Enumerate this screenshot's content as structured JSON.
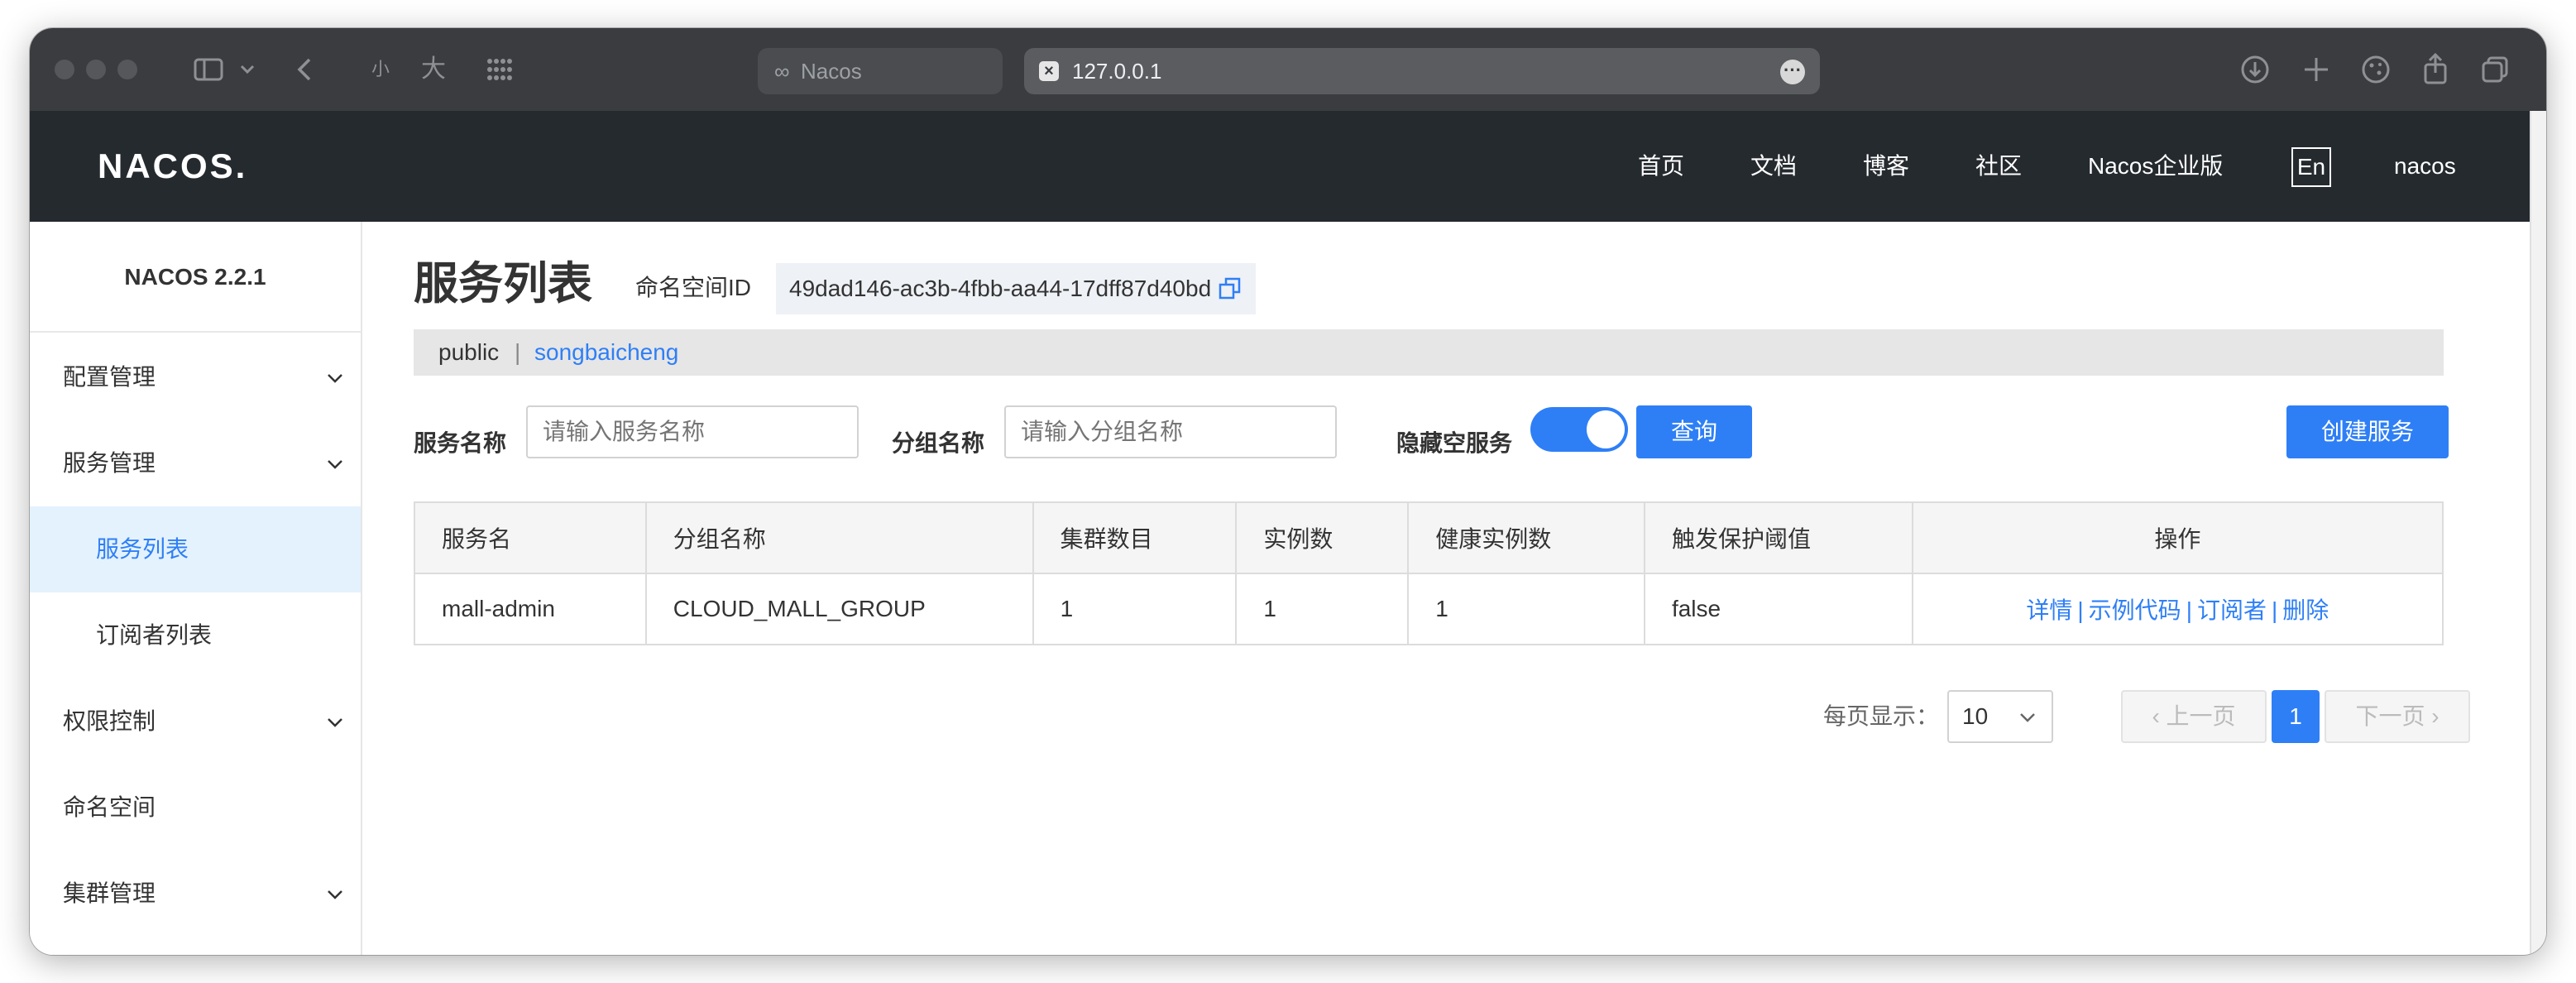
{
  "browser": {
    "inactive_tab": "Nacos",
    "url": "127.0.0.1",
    "zoom_small": "小",
    "zoom_large": "大"
  },
  "header": {
    "logo": "NACOS.",
    "nav": [
      "首页",
      "文档",
      "博客",
      "社区",
      "Nacos企业版"
    ],
    "lang": "En",
    "user": "nacos"
  },
  "sidebar": {
    "version": "NACOS 2.2.1",
    "items": [
      {
        "label": "配置管理",
        "expandable": true
      },
      {
        "label": "服务管理",
        "expandable": true
      },
      {
        "label": "服务列表",
        "sub": true,
        "active": true
      },
      {
        "label": "订阅者列表",
        "sub": true
      },
      {
        "label": "权限控制",
        "expandable": true
      },
      {
        "label": "命名空间",
        "expandable": false
      },
      {
        "label": "集群管理",
        "expandable": true
      }
    ]
  },
  "page": {
    "title": "服务列表",
    "namespace_label": "命名空间ID",
    "namespace_id": "49dad146-ac3b-4fbb-aa44-17dff87d40bd",
    "namespaces": {
      "public": "public",
      "separator": "|",
      "current": "songbaicheng"
    }
  },
  "filters": {
    "service_name_label": "服务名称",
    "service_name_placeholder": "请输入服务名称",
    "group_name_label": "分组名称",
    "group_name_placeholder": "请输入分组名称",
    "hide_empty_label": "隐藏空服务",
    "hide_empty_on": true,
    "query_button": "查询",
    "create_button": "创建服务"
  },
  "table": {
    "columns": [
      "服务名",
      "分组名称",
      "集群数目",
      "实例数",
      "健康实例数",
      "触发保护阈值",
      "操作"
    ],
    "rows": [
      {
        "name": "mall-admin",
        "group": "CLOUD_MALL_GROUP",
        "clusters": "1",
        "instances": "1",
        "healthy": "1",
        "threshold": "false",
        "ops": [
          "详情",
          "示例代码",
          "订阅者",
          "删除"
        ],
        "ops_sep": "|"
      }
    ]
  },
  "pagination": {
    "per_page_label": "每页显示：",
    "per_page": "10",
    "prev": "上一页",
    "current": "1",
    "next": "下一页"
  },
  "colors": {
    "accent": "#2e7ff6",
    "header_bg": "#252a2f",
    "active_bg": "#e4f2fe"
  }
}
